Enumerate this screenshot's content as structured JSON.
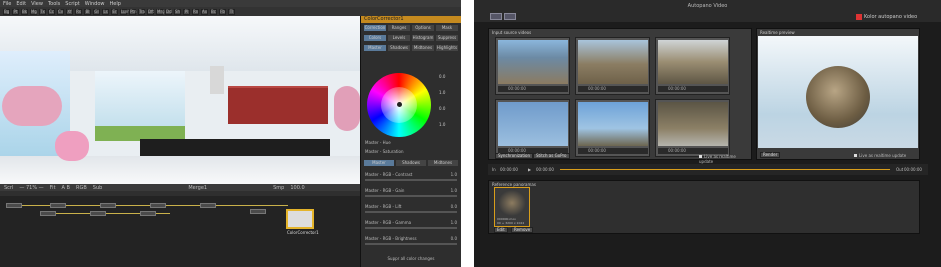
{
  "left": {
    "menu": [
      "File",
      "Edit",
      "View",
      "Tools",
      "Script",
      "Window",
      "Help"
    ],
    "toolbar_buttons": [
      "Bg",
      "Pt",
      "Bk",
      "Mg",
      "Tx",
      "Cc",
      "Cv",
      "Xf",
      "Rs",
      "Bl",
      "Gl",
      "Ls",
      "Er",
      "Lum",
      "Ptn",
      "Tra",
      "Dft",
      "Mrg",
      "Dcl",
      "Sh",
      "Pl",
      "Rn",
      "Ax",
      "Bc",
      "Fb",
      "Tl"
    ],
    "viewer_label": "Merge1",
    "midbar": [
      "Scrl",
      "— 71% —",
      "Fit",
      "A B",
      "RGB",
      "Sub",
      "Smp",
      "100.0"
    ],
    "flow_nodes": [
      "Loader1",
      "Loader2",
      "Loader3",
      "Loader4",
      "ColorCorrector1"
    ],
    "merge_node": "ColorCorrector1",
    "inspector": {
      "title": "ColorCorrector1",
      "tabs": [
        "Correction",
        "Ranges",
        "Options",
        "Mask",
        "Common"
      ],
      "subtabs": [
        "Colors",
        "Levels",
        "Histogram",
        "Suppress"
      ],
      "modes": [
        "Master",
        "Shadows",
        "Midtones",
        "Highlights"
      ],
      "values": [
        "0.0",
        "1.0",
        "0.0",
        "1.0"
      ],
      "rows": [
        "Contrast",
        "Gain",
        "Lift",
        "Gamma",
        "Brightness"
      ],
      "row_values": [
        "1.0",
        "1.0",
        "0.0",
        "1.0",
        "0.0"
      ],
      "color_ranges": [
        "Master - Hue",
        "Master - Saturation",
        "Master - RGB - Contrast",
        "Master - RGB - Gain",
        "Master - RGB - Lift",
        "Master - RGB - Gamma",
        "Master - RGB - Brightness"
      ],
      "footer": "Suppr all color changes"
    }
  },
  "right": {
    "title": "Autopano Video",
    "brand": "Kolor autopano video",
    "input_header": "Input source videos",
    "preview_header": "Realtime preview",
    "thumb_times": [
      "00:00:00",
      "00:00:00",
      "00:00:00",
      "00:00:00",
      "00:00:00",
      "00:00:00"
    ],
    "thumb_labels": [
      "",
      "",
      "",
      "cam 4",
      "cam 5",
      "cam 6"
    ],
    "sync_button": "Synchronization",
    "stitch_button": "Stitch as GoPro",
    "live_label": "Live as realtime update",
    "render_button": "Render",
    "preview_live_label": "Live as realtime update",
    "transport": {
      "in": "In",
      "in_time": "00:00:00",
      "out": "Out",
      "out_time": "00:00:00"
    },
    "ref_header": "Reference panoramas",
    "ref_name": "000000.mov",
    "ref_info": "00 + 3200 x 1024",
    "ref_buttons": [
      "Edit",
      "Remove"
    ]
  }
}
